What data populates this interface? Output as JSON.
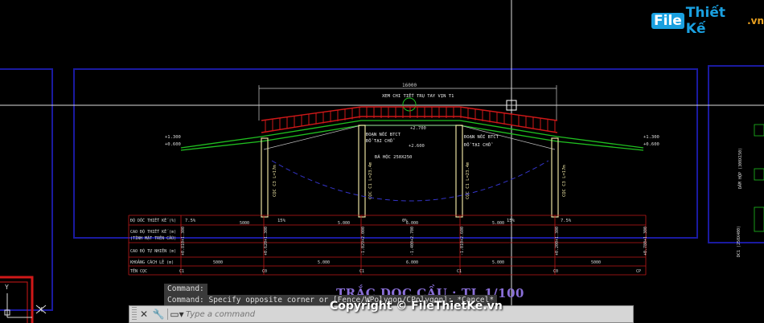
{
  "logo": {
    "part1": "File",
    "part2": "Thiết Kế",
    "part3": ".vn"
  },
  "drawing": {
    "span_dim": "16000",
    "ref_note": "XEM CHI TIẾT TRỤ TAY VỊN T1",
    "levels": {
      "left_top": "+1.300",
      "left_bot": "+0.600",
      "mid_left": "+2.700",
      "mid_right": "+2.600",
      "right_top": "+1.300",
      "right_bot": "+0.600"
    },
    "notes": {
      "joint_left_1": "ĐOẠN NỐI BTCT",
      "joint_left_2": "ĐỔ TẠI CHỖ",
      "joint_right_1": "ĐOẠN NỐI BTCT",
      "joint_right_2": "ĐỔ TẠI CHỖ",
      "stone": "ĐÁ HỘC 250X250"
    },
    "piles": {
      "p1": "CỌC C3 L=17m",
      "p2": "CỌC C1 L=23.4m",
      "p3": "CỌC C1 L=23.4m",
      "p4": "CỌC C3 L=17m"
    },
    "right_labels": [
      "DẦM HỘP (300X150)",
      "DC1 (250X400)"
    ]
  },
  "profile_table": {
    "row_labels": [
      "ĐỘ DỐC THIẾT KẾ (%)",
      "CAO ĐỘ THIẾT KẾ (m)",
      "(TÍNH MẶT TRÊN CẦU)",
      "CAO ĐỘ TỰ NHIÊN (m)",
      "KHOẢNG CÁCH LẺ (m)",
      "TÊN CỌC"
    ],
    "slopes": [
      "7.5%",
      "15%",
      "0%",
      "15%",
      "7.5%"
    ],
    "slope_lengths": [
      "5000",
      "5.000",
      "6.000",
      "5.000"
    ],
    "design_elev": [
      "+1.300",
      "+1.300",
      "+2.000",
      "+2.700",
      "+2.600",
      "+1.300",
      "+1.300"
    ],
    "natural_elev": [
      "+0.810",
      "+0.620",
      "-1.029",
      "-1.400",
      "-1.010",
      "+0.200",
      "+0.780"
    ],
    "distances": [
      "5000",
      "5.000",
      "6.000",
      "5.000",
      "5000"
    ],
    "station_names": [
      "C1",
      "C0",
      "C1",
      "C1",
      "C0",
      "CP"
    ]
  },
  "title": "TRẮC DỌC CẦU : TL 1/100",
  "command": {
    "history": [
      "Command:",
      "Command: Specify opposite corner or [Fence/WPolygon/CPolygon]: *Cancel*"
    ],
    "placeholder": "Type a command"
  },
  "watermark": "Copyright © FileThietKe.vn",
  "colors": {
    "background": "#000000",
    "frame": "#1a1aa0",
    "railing": "#d01818",
    "deck": "#20c020",
    "piles": "#e8e0a0",
    "table": "#c01818"
  }
}
